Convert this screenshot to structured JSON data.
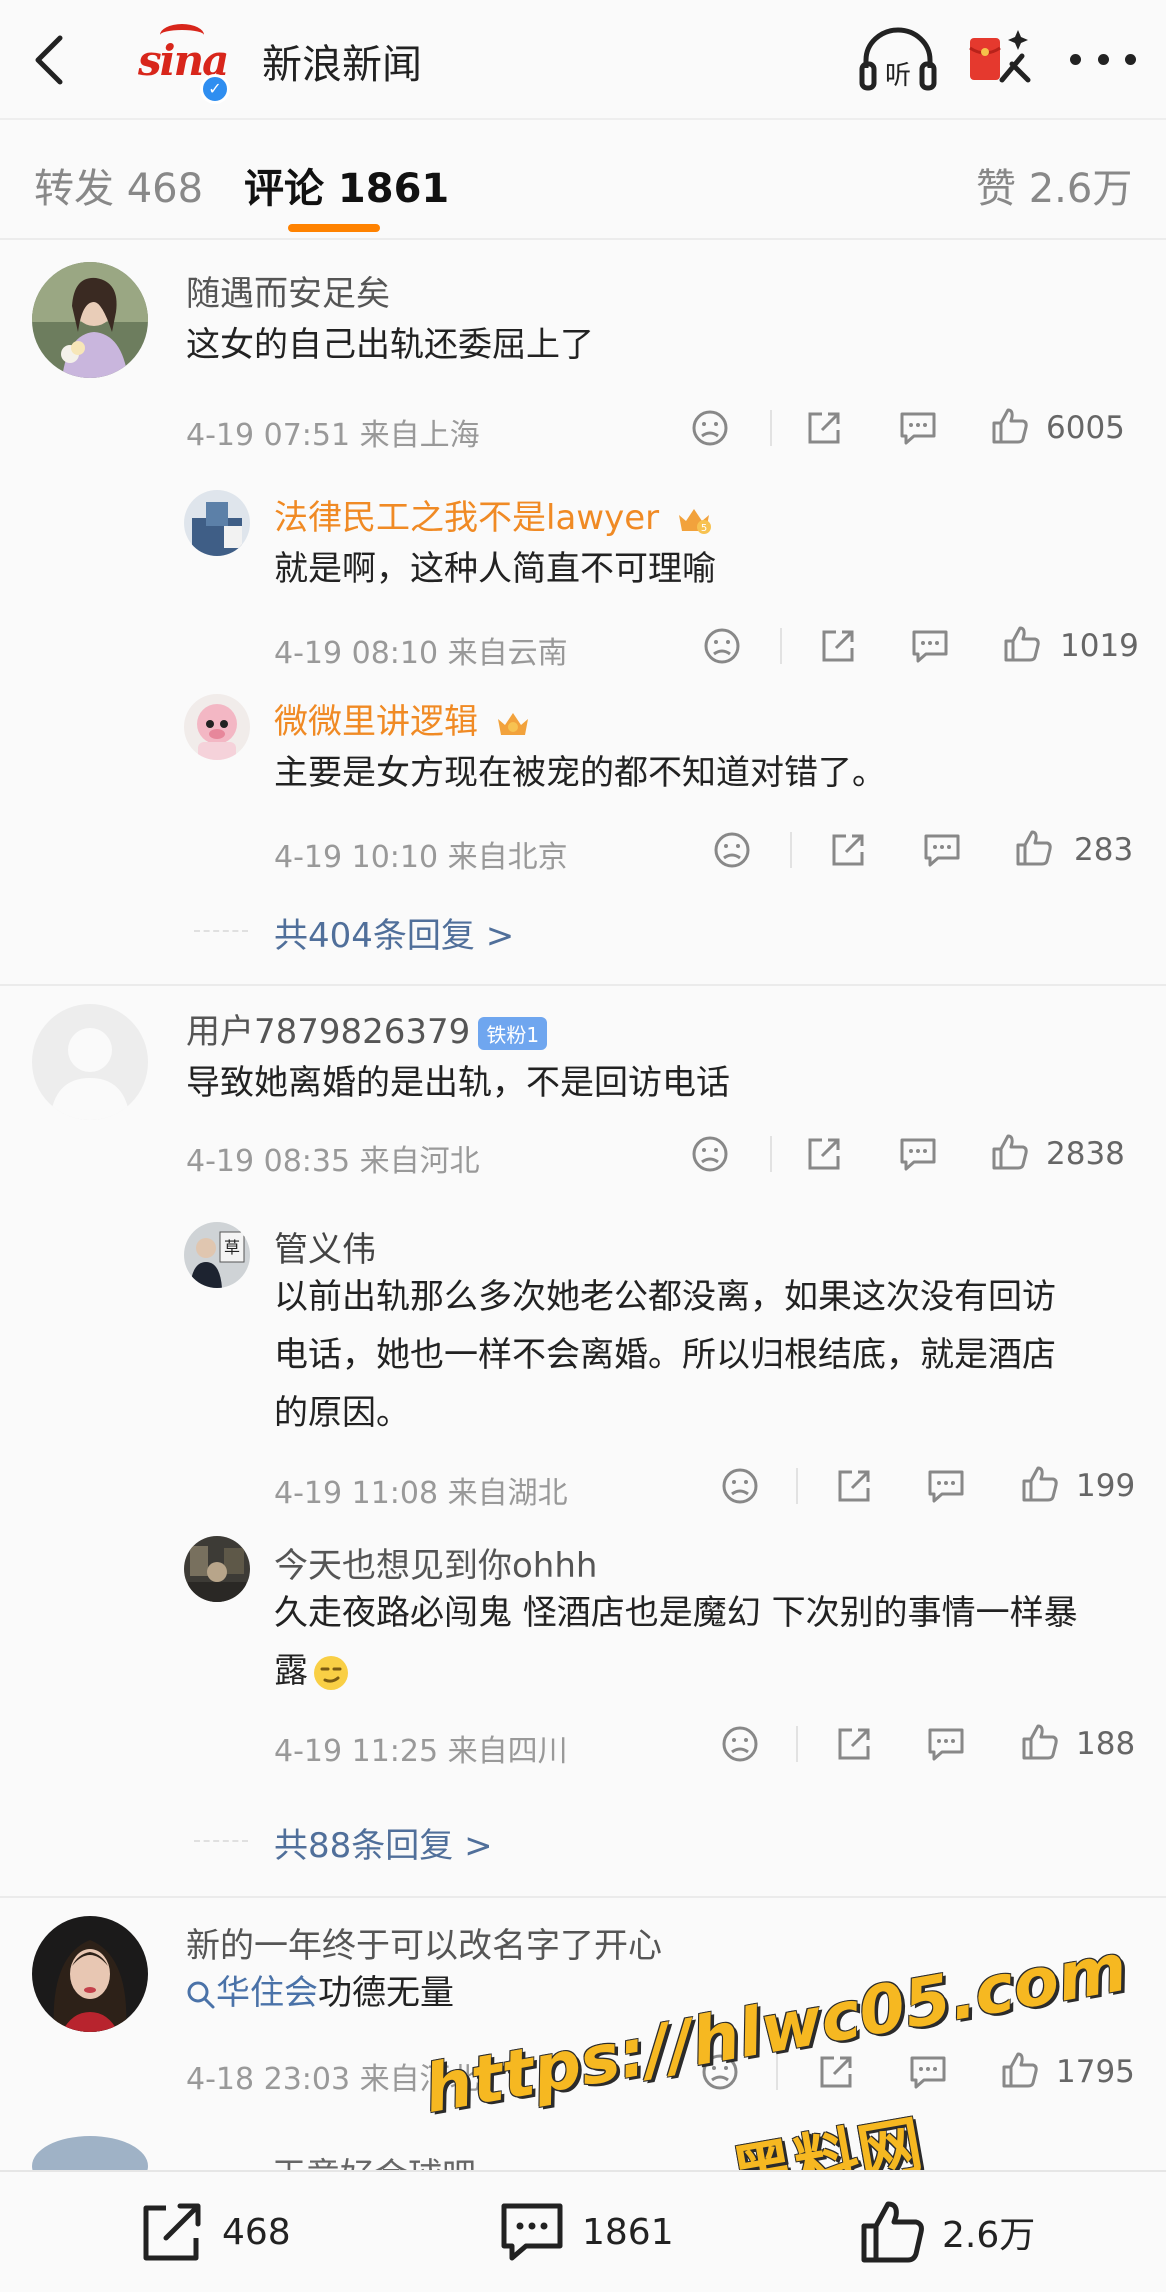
{
  "header": {
    "logo_text": "sina",
    "title": "新浪新闻",
    "listen_label": "听"
  },
  "tabs": {
    "repost": "转发 468",
    "comments": "评论 1861",
    "likes": "赞 2.6万"
  },
  "comments": [
    {
      "user": "随遇而安足矣",
      "text": "这女的自己出轨还委屈上了",
      "meta": "4-19 07:51  来自上海",
      "likes": "6005",
      "replies": [
        {
          "user": "法律民工之我不是lawyer",
          "badge": "5",
          "text": "就是啊，这种人简直不可理喻",
          "meta": "4-19 08:10  来自云南",
          "likes": "1019"
        },
        {
          "user": "微微里讲逻辑",
          "text": "主要是女方现在被宠的都不知道对错了。",
          "meta": "4-19 10:10  来自北京",
          "likes": "283"
        }
      ],
      "more_replies": "共404条回复 >"
    },
    {
      "user": "用户7879826379",
      "fan_badge": "铁粉1",
      "text": "导致她离婚的是出轨，不是回访电话",
      "meta": "4-19 08:35  来自河北",
      "likes": "2838",
      "replies": [
        {
          "user": "管义伟",
          "text_lines": [
            "以前出轨那么多次她老公都没离，如果这次没有回访",
            "电话，她也一样不会离婚。所以归根结底，就是酒店",
            "的原因。"
          ],
          "meta": "4-19 11:08  来自湖北",
          "likes": "199",
          "avatar_char": "草"
        },
        {
          "user": "今天也想见到你ohhh",
          "text_lines": [
            "久走夜路必闯鬼 怪酒店也是魔幻 下次别的事情一样暴",
            "露"
          ],
          "meta": "4-19 11:25  来自四川",
          "likes": "188"
        }
      ],
      "more_replies": "共88条回复 >"
    },
    {
      "user": "新的一年终于可以改名字了开心",
      "search_text": "华住会",
      "text_suffix": "功德无量",
      "meta": "4-18 23:03  来自河北",
      "likes": "1795"
    }
  ],
  "partial_next_user": "王意好会球吧",
  "watermark": {
    "line1": "https://hlwc05.com",
    "line2": "黑料网"
  },
  "bottom_bar": {
    "repost": "468",
    "comments": "1861",
    "likes": "2.6万"
  },
  "colors": {
    "accent": "#ff8200",
    "username_orange": "#f08a24",
    "link_blue": "#4a72a8",
    "sina_red": "#d8261b"
  }
}
